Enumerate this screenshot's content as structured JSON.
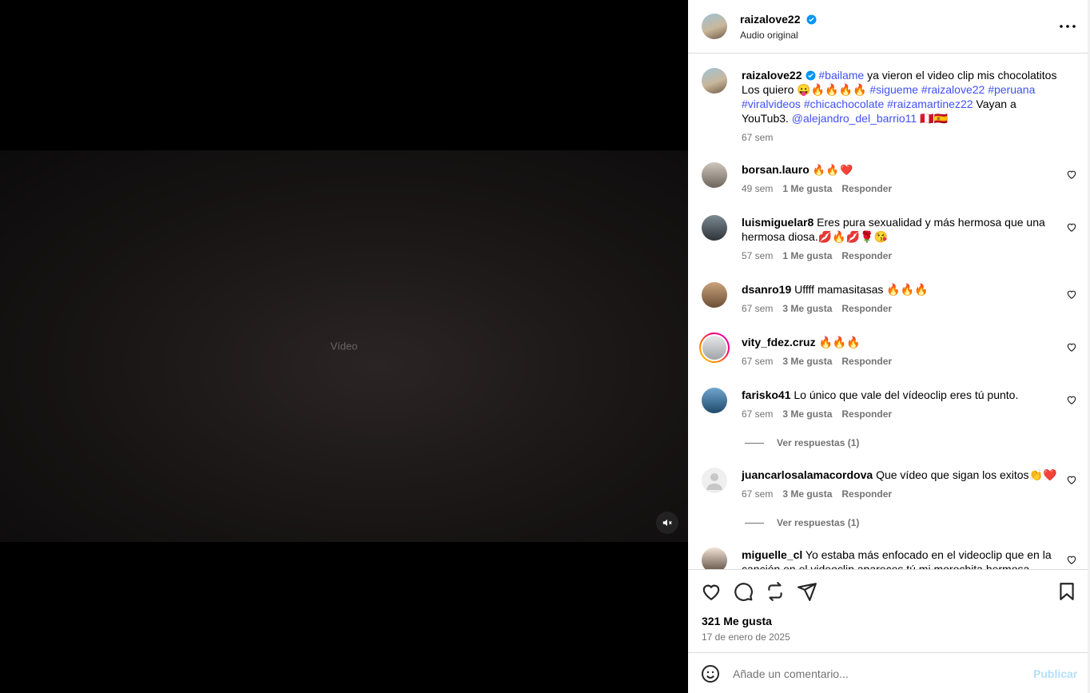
{
  "media": {
    "placeholder": "Vídeo",
    "mute_icon": "speaker-muted-icon"
  },
  "post": {
    "username": "raizalove22",
    "audio": "Audio original"
  },
  "caption": {
    "username": "raizalove22",
    "segments": [
      {
        "type": "hash",
        "text": "#bailame"
      },
      {
        "type": "text",
        "text": " ya vieron el video clip mis chocolatitos Los quiero 😛🔥🔥🔥🔥 "
      },
      {
        "type": "hash",
        "text": "#sigueme"
      },
      {
        "type": "text",
        "text": " "
      },
      {
        "type": "hash",
        "text": "#raizalove22"
      },
      {
        "type": "text",
        "text": " "
      },
      {
        "type": "hash",
        "text": "#peruana"
      },
      {
        "type": "text",
        "text": " "
      },
      {
        "type": "hash",
        "text": "#viralvideos"
      },
      {
        "type": "text",
        "text": " "
      },
      {
        "type": "hash",
        "text": "#chicachocolate"
      },
      {
        "type": "text",
        "text": " "
      },
      {
        "type": "hash",
        "text": "#raizamartinez22"
      },
      {
        "type": "text",
        "text": " Vayan a YouTub3. "
      },
      {
        "type": "hash",
        "text": "@alejandro_del_barrio11"
      },
      {
        "type": "text",
        "text": " 🇵🇪🇪🇸"
      }
    ],
    "time": "67 sem"
  },
  "comments": [
    {
      "username": "borsan.lauro",
      "text": "🔥🔥❤️",
      "time": "49 sem",
      "likes": "1 Me gusta",
      "reply": "Responder",
      "replies": ""
    },
    {
      "username": "luismiguelar8",
      "text": "Eres pura sexualidad y más hermosa que una hermosa diosa.💋🔥💋🌹😘",
      "time": "57 sem",
      "likes": "1 Me gusta",
      "reply": "Responder",
      "replies": ""
    },
    {
      "username": "dsanro19",
      "text": "Uffff mamasitasas 🔥🔥🔥",
      "time": "67 sem",
      "likes": "3 Me gusta",
      "reply": "Responder",
      "replies": ""
    },
    {
      "username": "vity_fdez.cruz",
      "text": "🔥🔥🔥",
      "time": "67 sem",
      "likes": "3 Me gusta",
      "reply": "Responder",
      "replies": ""
    },
    {
      "username": "farisko41",
      "text": "Lo único que vale del vídeoclip eres tú punto.",
      "time": "67 sem",
      "likes": "3 Me gusta",
      "reply": "Responder",
      "replies": "Ver respuestas (1)"
    },
    {
      "username": "juancarlosalamacordova",
      "text": "Que vídeo que sigan los exitos👏❤️",
      "time": "67 sem",
      "likes": "3 Me gusta",
      "reply": "Responder",
      "replies": "Ver respuestas (1)"
    },
    {
      "username": "miguelle_cl",
      "text": "Yo estaba más enfocado en el videoclip que en la canción en el videoclip apareces tú mi morochita hermosa",
      "time": "",
      "likes": "",
      "reply": "",
      "replies": ""
    }
  ],
  "stats": {
    "likes": "321 Me gusta",
    "date": "17 de enero de 2025"
  },
  "composer": {
    "placeholder": "Añade un comentario...",
    "publish": "Publicar"
  },
  "colors": {
    "hashtag": "#4150f7",
    "verified": "#0095f6",
    "publish_disabled": "#b2dffc",
    "story_ring": "#d300c5"
  }
}
